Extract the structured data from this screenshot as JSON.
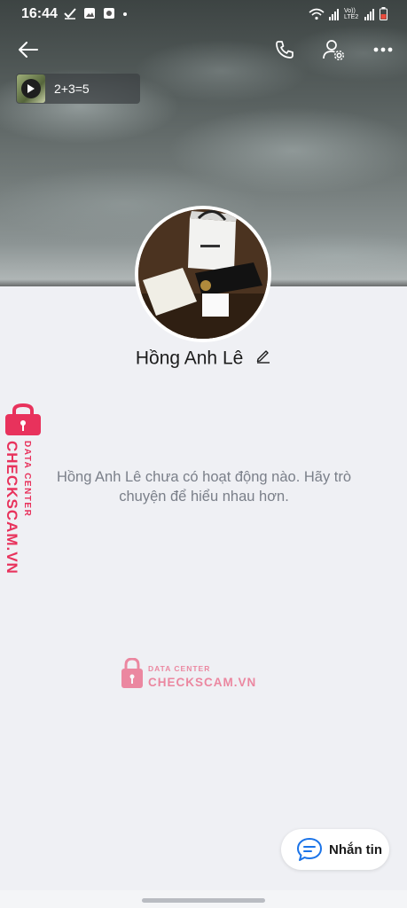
{
  "status_bar": {
    "time": "16:44",
    "network_label": "Vo)) LTE2"
  },
  "story": {
    "label": "2+3=5"
  },
  "profile": {
    "name": "Hồng Anh Lê",
    "empty_message": "Hồng Anh Lê chưa có hoạt động nào. Hãy trò chuyện để hiểu nhau hơn."
  },
  "watermark": {
    "brand": "CHECKSCAM.VN",
    "tagline": "DATA CENTER"
  },
  "actions": {
    "message_label": "Nhắn tin"
  },
  "colors": {
    "accent": "#1a73e8",
    "watermark": "#e8325c"
  }
}
